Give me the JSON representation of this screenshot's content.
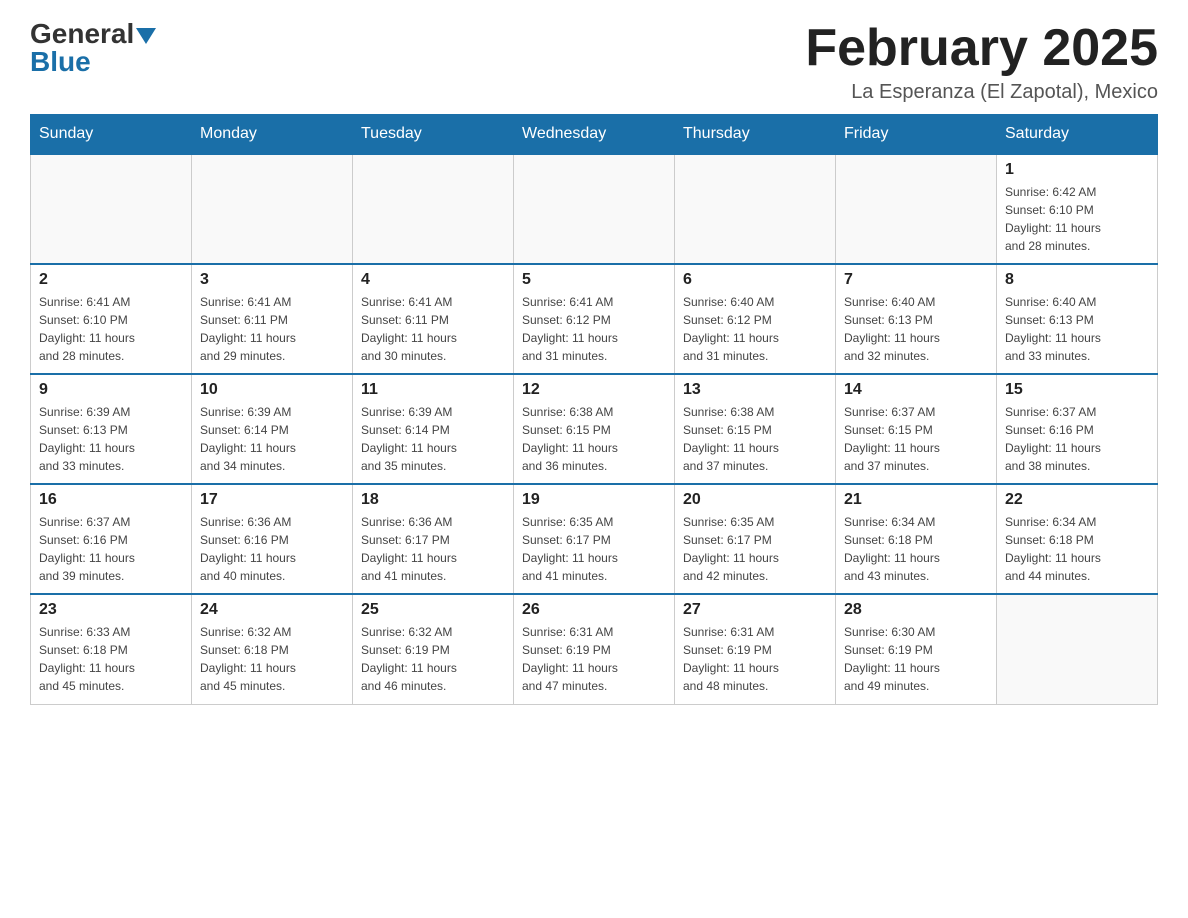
{
  "header": {
    "logo_general": "General",
    "logo_blue": "Blue",
    "month_title": "February 2025",
    "location": "La Esperanza (El Zapotal), Mexico"
  },
  "weekdays": [
    "Sunday",
    "Monday",
    "Tuesday",
    "Wednesday",
    "Thursday",
    "Friday",
    "Saturday"
  ],
  "weeks": [
    [
      {
        "day": "",
        "info": ""
      },
      {
        "day": "",
        "info": ""
      },
      {
        "day": "",
        "info": ""
      },
      {
        "day": "",
        "info": ""
      },
      {
        "day": "",
        "info": ""
      },
      {
        "day": "",
        "info": ""
      },
      {
        "day": "1",
        "info": "Sunrise: 6:42 AM\nSunset: 6:10 PM\nDaylight: 11 hours\nand 28 minutes."
      }
    ],
    [
      {
        "day": "2",
        "info": "Sunrise: 6:41 AM\nSunset: 6:10 PM\nDaylight: 11 hours\nand 28 minutes."
      },
      {
        "day": "3",
        "info": "Sunrise: 6:41 AM\nSunset: 6:11 PM\nDaylight: 11 hours\nand 29 minutes."
      },
      {
        "day": "4",
        "info": "Sunrise: 6:41 AM\nSunset: 6:11 PM\nDaylight: 11 hours\nand 30 minutes."
      },
      {
        "day": "5",
        "info": "Sunrise: 6:41 AM\nSunset: 6:12 PM\nDaylight: 11 hours\nand 31 minutes."
      },
      {
        "day": "6",
        "info": "Sunrise: 6:40 AM\nSunset: 6:12 PM\nDaylight: 11 hours\nand 31 minutes."
      },
      {
        "day": "7",
        "info": "Sunrise: 6:40 AM\nSunset: 6:13 PM\nDaylight: 11 hours\nand 32 minutes."
      },
      {
        "day": "8",
        "info": "Sunrise: 6:40 AM\nSunset: 6:13 PM\nDaylight: 11 hours\nand 33 minutes."
      }
    ],
    [
      {
        "day": "9",
        "info": "Sunrise: 6:39 AM\nSunset: 6:13 PM\nDaylight: 11 hours\nand 33 minutes."
      },
      {
        "day": "10",
        "info": "Sunrise: 6:39 AM\nSunset: 6:14 PM\nDaylight: 11 hours\nand 34 minutes."
      },
      {
        "day": "11",
        "info": "Sunrise: 6:39 AM\nSunset: 6:14 PM\nDaylight: 11 hours\nand 35 minutes."
      },
      {
        "day": "12",
        "info": "Sunrise: 6:38 AM\nSunset: 6:15 PM\nDaylight: 11 hours\nand 36 minutes."
      },
      {
        "day": "13",
        "info": "Sunrise: 6:38 AM\nSunset: 6:15 PM\nDaylight: 11 hours\nand 37 minutes."
      },
      {
        "day": "14",
        "info": "Sunrise: 6:37 AM\nSunset: 6:15 PM\nDaylight: 11 hours\nand 37 minutes."
      },
      {
        "day": "15",
        "info": "Sunrise: 6:37 AM\nSunset: 6:16 PM\nDaylight: 11 hours\nand 38 minutes."
      }
    ],
    [
      {
        "day": "16",
        "info": "Sunrise: 6:37 AM\nSunset: 6:16 PM\nDaylight: 11 hours\nand 39 minutes."
      },
      {
        "day": "17",
        "info": "Sunrise: 6:36 AM\nSunset: 6:16 PM\nDaylight: 11 hours\nand 40 minutes."
      },
      {
        "day": "18",
        "info": "Sunrise: 6:36 AM\nSunset: 6:17 PM\nDaylight: 11 hours\nand 41 minutes."
      },
      {
        "day": "19",
        "info": "Sunrise: 6:35 AM\nSunset: 6:17 PM\nDaylight: 11 hours\nand 41 minutes."
      },
      {
        "day": "20",
        "info": "Sunrise: 6:35 AM\nSunset: 6:17 PM\nDaylight: 11 hours\nand 42 minutes."
      },
      {
        "day": "21",
        "info": "Sunrise: 6:34 AM\nSunset: 6:18 PM\nDaylight: 11 hours\nand 43 minutes."
      },
      {
        "day": "22",
        "info": "Sunrise: 6:34 AM\nSunset: 6:18 PM\nDaylight: 11 hours\nand 44 minutes."
      }
    ],
    [
      {
        "day": "23",
        "info": "Sunrise: 6:33 AM\nSunset: 6:18 PM\nDaylight: 11 hours\nand 45 minutes."
      },
      {
        "day": "24",
        "info": "Sunrise: 6:32 AM\nSunset: 6:18 PM\nDaylight: 11 hours\nand 45 minutes."
      },
      {
        "day": "25",
        "info": "Sunrise: 6:32 AM\nSunset: 6:19 PM\nDaylight: 11 hours\nand 46 minutes."
      },
      {
        "day": "26",
        "info": "Sunrise: 6:31 AM\nSunset: 6:19 PM\nDaylight: 11 hours\nand 47 minutes."
      },
      {
        "day": "27",
        "info": "Sunrise: 6:31 AM\nSunset: 6:19 PM\nDaylight: 11 hours\nand 48 minutes."
      },
      {
        "day": "28",
        "info": "Sunrise: 6:30 AM\nSunset: 6:19 PM\nDaylight: 11 hours\nand 49 minutes."
      },
      {
        "day": "",
        "info": ""
      }
    ]
  ]
}
